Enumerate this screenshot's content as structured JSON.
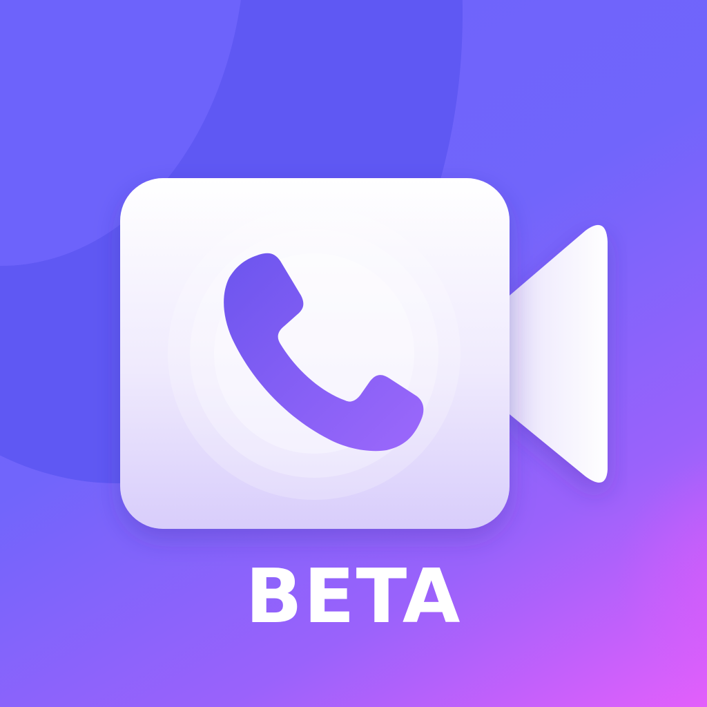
{
  "badge": {
    "label": "BETA"
  },
  "icons": {
    "main": "video-camera-icon",
    "inner": "phone-handset-icon"
  },
  "colors": {
    "background_top": "#6d63fb",
    "background_bottom_right": "#e35ffb",
    "accent": "#7c5cf8",
    "camera_body": "#f3f0fd",
    "label": "#ffffff"
  }
}
